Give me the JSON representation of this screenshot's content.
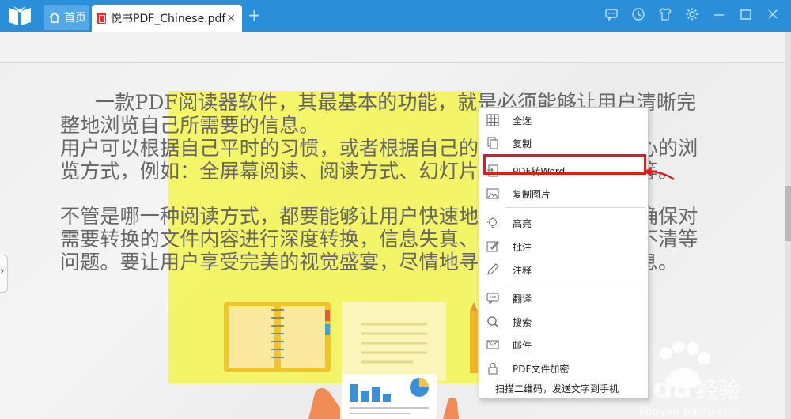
{
  "titlebar": {
    "home_tab": "首页",
    "doc_tab": "悦书PDF_Chinese.pdf",
    "close_symbol": "×",
    "add_symbol": "+",
    "icons": [
      "comment-icon",
      "clock-icon",
      "shirt-icon",
      "gear-icon",
      "minimize-icon",
      "maximize-icon",
      "close-icon"
    ]
  },
  "document": {
    "paragraph1": "一款PDF阅读器软件，其最基本的功能，就是必须能够让用户清晰完整地浏览自己所需要的信息。",
    "paragraph2": "用户可以根据自己平时的习惯，或者根据自己的需要，选择自己倾心的浏览方式，例如：全屏幕阅读、阅读方式、幻灯片自动放映阅读方式等。",
    "paragraph3": "不管是哪一种阅读方式，都要能够让用户快速地获取信息。并且要确保对需要转换的文件内容进行深度转换，信息失真、遗漏、乱码、模糊不清等问题。要让用户享受完美的视觉盛宴，尽情地寻找他们所需要的信息。"
  },
  "context_menu": {
    "items": [
      {
        "label": "全选",
        "icon": "grid-icon"
      },
      {
        "label": "复制",
        "icon": "copy-icon"
      },
      {
        "label": "PDF转Word",
        "icon": "pdf-to-word-icon"
      },
      {
        "label": "复制图片",
        "icon": "image-icon"
      },
      {
        "label": "高亮",
        "icon": "bulb-icon"
      },
      {
        "label": "批注",
        "icon": "annotate-icon"
      },
      {
        "label": "注释",
        "icon": "pen-icon"
      },
      {
        "label": "翻译",
        "icon": "translate-icon"
      },
      {
        "label": "搜索",
        "icon": "search-icon"
      },
      {
        "label": "邮件",
        "icon": "mail-icon"
      },
      {
        "label": "PDF文件加密",
        "icon": "lock-icon"
      }
    ],
    "footer": "扫描二维码，发送文字到手机",
    "highlighted_item": "复制图片"
  },
  "colors": {
    "titlebar": "#2a8ed8",
    "selection": "#f5f550",
    "highlight_border": "#e3191d"
  },
  "watermark": {
    "logo_text": "Baidu经验",
    "url": "jingyan.baidu.com"
  }
}
